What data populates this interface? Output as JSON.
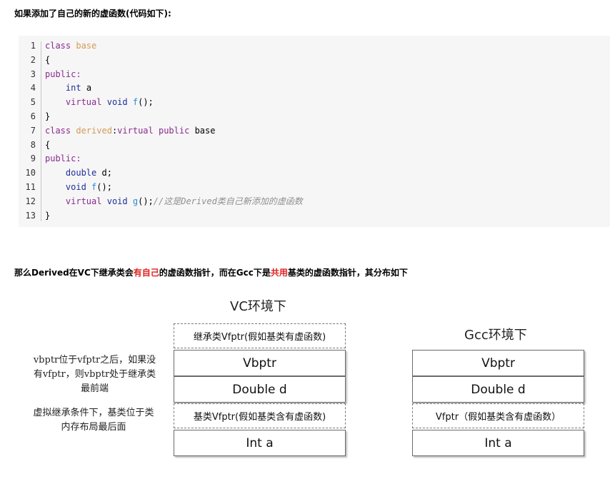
{
  "heading1": "如果添加了自己的新的虚函数(代码如下):",
  "code": {
    "line_numbers": [
      "1",
      "2",
      "3",
      "4",
      "5",
      "6",
      "7",
      "8",
      "9",
      "10",
      "11",
      "12",
      "13"
    ],
    "l1": {
      "kw": "class",
      "name": "base"
    },
    "l2": "{",
    "l3": "public:",
    "l4": {
      "indent": "    ",
      "type": "int",
      "rest": " a"
    },
    "l5": {
      "indent": "    ",
      "kw": "virtual",
      "type": "void",
      "fn": "f",
      "rest": "();"
    },
    "l6": "}",
    "l7": {
      "kw": "class",
      "name": "derived",
      "rest1": ":",
      "kw2": "virtual",
      "kw3": "public",
      "rest2": " base"
    },
    "l8": "{",
    "l9": "public:",
    "l10": {
      "indent": "    ",
      "type": "double",
      "rest": " d;"
    },
    "l11": {
      "indent": "    ",
      "type": "void",
      "fn": "f",
      "rest": "();"
    },
    "l12": {
      "indent": "    ",
      "kw": "virtual",
      "type": "void",
      "fn": "g",
      "rest": "();",
      "comment": "//这是Derived类自己新添加的虚函数"
    },
    "l13": "}"
  },
  "heading2": {
    "part1": "那么Derived在VC下继承类会",
    "red1": "有自己",
    "part2": "的虚函数指针，而在Gcc下是",
    "red2": "共用",
    "part3": "基类的虚函数指针，其分布如下"
  },
  "vc": {
    "title": "VC环境下",
    "boxes": [
      "继承类Vfptr(假如基类有虚函数)",
      "Vbptr",
      "Double d",
      "基类Vfptr(假如基类含有虚函数)",
      "Int a"
    ],
    "note1": [
      "vbptr位于vfptr之后，如果没",
      "有vfptr，则vbptr处于继承类",
      "最前端"
    ],
    "note2": [
      "虚拟继承条件下，基类位于类",
      "内存布局最后面"
    ]
  },
  "gcc": {
    "title": "Gcc环境下",
    "boxes": [
      "Vbptr",
      "Double d",
      "Vfptr（假如基类含有虚函数）",
      "Int a"
    ]
  },
  "colors": {
    "highlight": "#e02020",
    "code_bg": "#f6f6f6",
    "keyword": "#8a2b8f",
    "class_name": "#d49a56",
    "function": "#2b8bd6",
    "comment": "#8f8f8f"
  }
}
